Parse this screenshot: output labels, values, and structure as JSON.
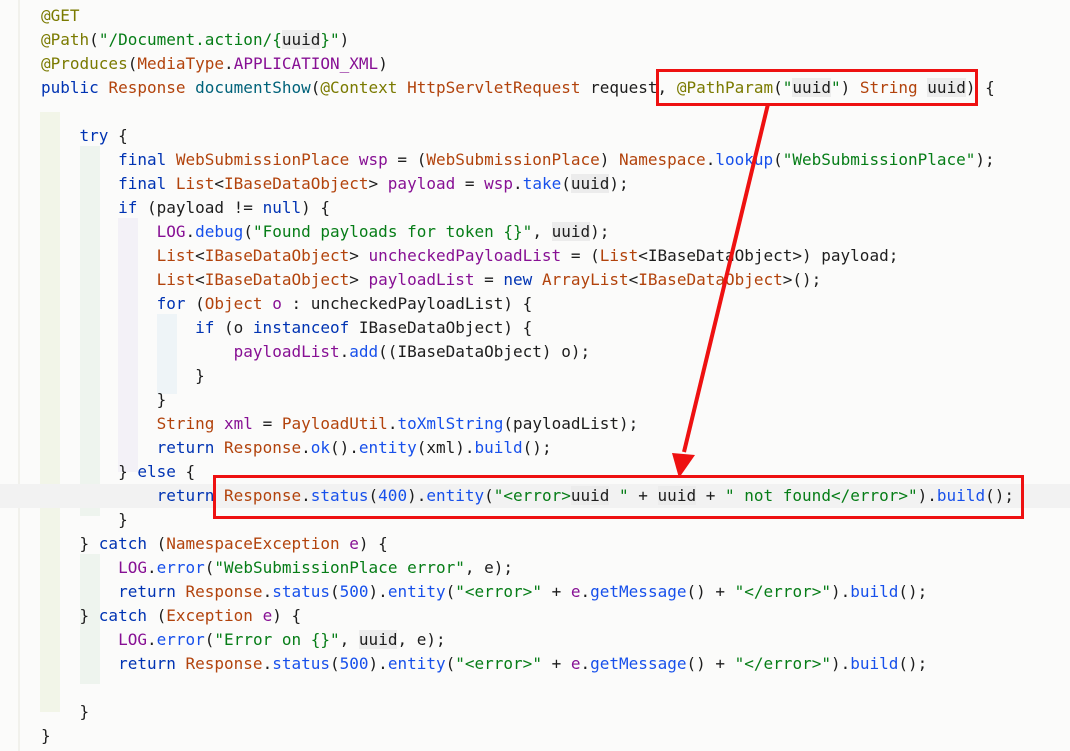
{
  "code": {
    "lines": [
      [
        [
          "ann",
          "@GET"
        ]
      ],
      [
        [
          "ann",
          "@Path"
        ],
        [
          "plain",
          "("
        ],
        [
          "str",
          "\"/Document.action/{"
        ],
        [
          "sel",
          "uuid"
        ],
        [
          "str",
          "}\""
        ],
        [
          "plain",
          ")"
        ]
      ],
      [
        [
          "ann",
          "@Produces"
        ],
        [
          "plain",
          "("
        ],
        [
          "cls",
          "MediaType"
        ],
        [
          "plain",
          "."
        ],
        [
          "cst",
          "APPLICATION_XML"
        ],
        [
          "plain",
          ")"
        ]
      ],
      [
        [
          "kw",
          "public "
        ],
        [
          "cls",
          "Response "
        ],
        [
          "meth",
          "documentShow"
        ],
        [
          "plain",
          "("
        ],
        [
          "ann",
          "@Context "
        ],
        [
          "cls",
          "HttpServletRequest "
        ],
        [
          "plain",
          "request, "
        ],
        [
          "ann",
          "@PathParam"
        ],
        [
          "plain",
          "("
        ],
        [
          "str",
          "\""
        ],
        [
          "sel",
          "uuid"
        ],
        [
          "str",
          "\""
        ],
        [
          "plain",
          ") "
        ],
        [
          "cls",
          "String "
        ],
        [
          "sel",
          "uuid"
        ],
        [
          "plain",
          ") {"
        ]
      ],
      [],
      [
        [
          "plain",
          "    "
        ],
        [
          "kw",
          "try"
        ],
        [
          "plain",
          " {"
        ]
      ],
      [
        [
          "plain",
          "        "
        ],
        [
          "kw",
          "final "
        ],
        [
          "cls",
          "WebSubmissionPlace "
        ],
        [
          "field",
          "wsp"
        ],
        [
          "plain",
          " = ("
        ],
        [
          "cls",
          "WebSubmissionPlace"
        ],
        [
          "plain",
          ") "
        ],
        [
          "cls",
          "Namespace"
        ],
        [
          "plain",
          "."
        ],
        [
          "call",
          "lookup"
        ],
        [
          "plain",
          "("
        ],
        [
          "str",
          "\"WebSubmissionPlace\""
        ],
        [
          "plain",
          ");"
        ]
      ],
      [
        [
          "plain",
          "        "
        ],
        [
          "kw",
          "final "
        ],
        [
          "cls",
          "List"
        ],
        [
          "plain",
          "<"
        ],
        [
          "cls",
          "IBaseDataObject"
        ],
        [
          "plain",
          "> "
        ],
        [
          "field",
          "payload"
        ],
        [
          "plain",
          " = "
        ],
        [
          "field",
          "wsp"
        ],
        [
          "plain",
          "."
        ],
        [
          "call",
          "take"
        ],
        [
          "plain",
          "("
        ],
        [
          "sel",
          "uuid"
        ],
        [
          "plain",
          ");"
        ]
      ],
      [
        [
          "plain",
          "        "
        ],
        [
          "kw",
          "if"
        ],
        [
          "plain",
          " (payload != "
        ],
        [
          "kw",
          "null"
        ],
        [
          "plain",
          ") {"
        ]
      ],
      [
        [
          "plain",
          "            "
        ],
        [
          "cst",
          "LOG"
        ],
        [
          "plain",
          "."
        ],
        [
          "call",
          "debug"
        ],
        [
          "plain",
          "("
        ],
        [
          "str",
          "\"Found payloads for token {}\""
        ],
        [
          "plain",
          ", "
        ],
        [
          "sel",
          "uuid"
        ],
        [
          "plain",
          ");"
        ]
      ],
      [
        [
          "plain",
          "            "
        ],
        [
          "cls",
          "List"
        ],
        [
          "plain",
          "<"
        ],
        [
          "cls",
          "IBaseDataObject"
        ],
        [
          "plain",
          "> "
        ],
        [
          "field",
          "uncheckedPayloadList"
        ],
        [
          "plain",
          " = ("
        ],
        [
          "cls",
          "List"
        ],
        [
          "plain",
          "<IBaseDataObject>) payload;"
        ]
      ],
      [
        [
          "plain",
          "            "
        ],
        [
          "cls",
          "List"
        ],
        [
          "plain",
          "<"
        ],
        [
          "cls",
          "IBaseDataObject"
        ],
        [
          "plain",
          "> "
        ],
        [
          "field",
          "payloadList"
        ],
        [
          "plain",
          " = "
        ],
        [
          "kw",
          "new "
        ],
        [
          "cls",
          "ArrayList"
        ],
        [
          "plain",
          "<"
        ],
        [
          "cls",
          "IBaseDataObject"
        ],
        [
          "plain",
          ">();"
        ]
      ],
      [
        [
          "plain",
          "            "
        ],
        [
          "kw",
          "for"
        ],
        [
          "plain",
          " ("
        ],
        [
          "cls",
          "Object "
        ],
        [
          "field",
          "o"
        ],
        [
          "plain",
          " : uncheckedPayloadList) {"
        ]
      ],
      [
        [
          "plain",
          "                "
        ],
        [
          "kw",
          "if"
        ],
        [
          "plain",
          " (o "
        ],
        [
          "kw",
          "instanceof"
        ],
        [
          "plain",
          " IBaseDataObject) {"
        ]
      ],
      [
        [
          "plain",
          "                    "
        ],
        [
          "field",
          "payloadList"
        ],
        [
          "plain",
          "."
        ],
        [
          "call",
          "add"
        ],
        [
          "plain",
          "((IBaseDataObject) o);"
        ]
      ],
      [
        [
          "plain",
          "                }"
        ]
      ],
      [
        [
          "plain",
          "            }"
        ]
      ],
      [
        [
          "plain",
          "            "
        ],
        [
          "cls",
          "String "
        ],
        [
          "field",
          "xml"
        ],
        [
          "plain",
          " = "
        ],
        [
          "cls",
          "PayloadUtil"
        ],
        [
          "plain",
          "."
        ],
        [
          "call",
          "toXmlString"
        ],
        [
          "plain",
          "(payloadList);"
        ]
      ],
      [
        [
          "plain",
          "            "
        ],
        [
          "kw",
          "return "
        ],
        [
          "cls",
          "Response"
        ],
        [
          "plain",
          "."
        ],
        [
          "call",
          "ok"
        ],
        [
          "plain",
          "()."
        ],
        [
          "call",
          "entity"
        ],
        [
          "plain",
          "(xml)."
        ],
        [
          "call",
          "build"
        ],
        [
          "plain",
          "();"
        ]
      ],
      [
        [
          "plain",
          "        } "
        ],
        [
          "kw",
          "else"
        ],
        [
          "plain",
          " {"
        ]
      ],
      [
        [
          "plain",
          "            "
        ],
        [
          "kw",
          "return "
        ],
        [
          "cls",
          "Response"
        ],
        [
          "plain",
          "."
        ],
        [
          "call",
          "status"
        ],
        [
          "plain",
          "("
        ],
        [
          "num",
          "400"
        ],
        [
          "plain",
          ")."
        ],
        [
          "call",
          "entity"
        ],
        [
          "plain",
          "("
        ],
        [
          "str",
          "\"<error>"
        ],
        [
          "sel",
          "uuid"
        ],
        [
          "str",
          " \""
        ],
        [
          "plain",
          " + "
        ],
        [
          "sel",
          "uuid"
        ],
        [
          "plain",
          " + "
        ],
        [
          "str",
          "\" not found</error>\""
        ],
        [
          "plain",
          ")."
        ],
        [
          "call",
          "build"
        ],
        [
          "plain",
          "();"
        ]
      ],
      [
        [
          "plain",
          "        }"
        ]
      ],
      [
        [
          "plain",
          "    } "
        ],
        [
          "kw",
          "catch"
        ],
        [
          "plain",
          " ("
        ],
        [
          "cls",
          "NamespaceException "
        ],
        [
          "field",
          "e"
        ],
        [
          "plain",
          ") {"
        ]
      ],
      [
        [
          "plain",
          "        "
        ],
        [
          "cst",
          "LOG"
        ],
        [
          "plain",
          "."
        ],
        [
          "call",
          "error"
        ],
        [
          "plain",
          "("
        ],
        [
          "str",
          "\"WebSubmissionPlace error\""
        ],
        [
          "plain",
          ", e);"
        ]
      ],
      [
        [
          "plain",
          "        "
        ],
        [
          "kw",
          "return "
        ],
        [
          "cls",
          "Response"
        ],
        [
          "plain",
          "."
        ],
        [
          "call",
          "status"
        ],
        [
          "plain",
          "("
        ],
        [
          "num",
          "500"
        ],
        [
          "plain",
          ")."
        ],
        [
          "call",
          "entity"
        ],
        [
          "plain",
          "("
        ],
        [
          "str",
          "\"<error>\""
        ],
        [
          "plain",
          " + "
        ],
        [
          "field",
          "e"
        ],
        [
          "plain",
          "."
        ],
        [
          "call",
          "getMessage"
        ],
        [
          "plain",
          "() + "
        ],
        [
          "str",
          "\"</error>\""
        ],
        [
          "plain",
          ")."
        ],
        [
          "call",
          "build"
        ],
        [
          "plain",
          "();"
        ]
      ],
      [
        [
          "plain",
          "    } "
        ],
        [
          "kw",
          "catch"
        ],
        [
          "plain",
          " ("
        ],
        [
          "cls",
          "Exception "
        ],
        [
          "field",
          "e"
        ],
        [
          "plain",
          ") {"
        ]
      ],
      [
        [
          "plain",
          "        "
        ],
        [
          "cst",
          "LOG"
        ],
        [
          "plain",
          "."
        ],
        [
          "call",
          "error"
        ],
        [
          "plain",
          "("
        ],
        [
          "str",
          "\"Error on {}\""
        ],
        [
          "plain",
          ", "
        ],
        [
          "sel",
          "uuid"
        ],
        [
          "plain",
          ", e);"
        ]
      ],
      [
        [
          "plain",
          "        "
        ],
        [
          "kw",
          "return "
        ],
        [
          "cls",
          "Response"
        ],
        [
          "plain",
          "."
        ],
        [
          "call",
          "status"
        ],
        [
          "plain",
          "("
        ],
        [
          "num",
          "500"
        ],
        [
          "plain",
          ")."
        ],
        [
          "call",
          "entity"
        ],
        [
          "plain",
          "("
        ],
        [
          "str",
          "\"<error>\""
        ],
        [
          "plain",
          " + "
        ],
        [
          "field",
          "e"
        ],
        [
          "plain",
          "."
        ],
        [
          "call",
          "getMessage"
        ],
        [
          "plain",
          "() + "
        ],
        [
          "str",
          "\"</error>\""
        ],
        [
          "plain",
          ")."
        ],
        [
          "call",
          "build"
        ],
        [
          "plain",
          "();"
        ]
      ],
      [],
      [
        [
          "plain",
          "    }"
        ]
      ],
      [
        [
          "plain",
          "}"
        ]
      ]
    ]
  },
  "annotations": {
    "highlight_top_target": "@PathParam(\"uuid\") String uuid)",
    "highlight_bottom_target": "Response.status(400).entity(\"<error>uuid \" + uuid + \" not found</error>\").build();",
    "box_color": "#ee1111"
  },
  "colors": {
    "background": "#fbfbfa",
    "keyword": "#0033b3",
    "string": "#067d17",
    "annotation": "#7a7a00"
  }
}
